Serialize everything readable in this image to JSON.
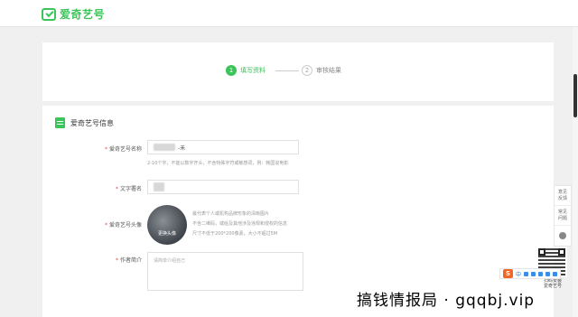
{
  "app": {
    "logo_text": "爱奇艺号",
    "brand_color": "#3ac45a"
  },
  "steps": [
    {
      "num": "1",
      "label": "填写资料",
      "active": true
    },
    {
      "num": "2",
      "label": "审核结果",
      "active": false
    }
  ],
  "section": {
    "title": "爱奇艺号信息"
  },
  "form": {
    "name": {
      "label": "爱奇艺号名称",
      "value_suffix": "-禾",
      "hint": "2-10个字，不能以数字开头，不含特殊字符或敏感词，例：韩国说电影"
    },
    "signature": {
      "label": "文字署名"
    },
    "avatar": {
      "label": "爱奇艺号头像",
      "overlay_text": "更换头像",
      "hints": [
        "最代表个人或机构品牌形象的清晰图片",
        "不含二维码，或给及其他涉及违规和侵权的信息",
        "尺寸不低于200*200像素，大小不超过5M"
      ]
    },
    "bio": {
      "label": "作者简介",
      "placeholder": "请简单介绍自己"
    }
  },
  "side_widget": {
    "items": [
      {
        "label_line1": "意见",
        "label_line2": "反馈"
      },
      {
        "label_line1": "常见",
        "label_line2": "问题"
      }
    ]
  },
  "qr": {
    "caption_line1": "扫码安装",
    "caption_line2": "爱奇艺号"
  },
  "ime": {
    "mode": "中",
    "brand": "S"
  },
  "watermark": {
    "text": "搞钱情报局 · gqqbj.vip"
  }
}
